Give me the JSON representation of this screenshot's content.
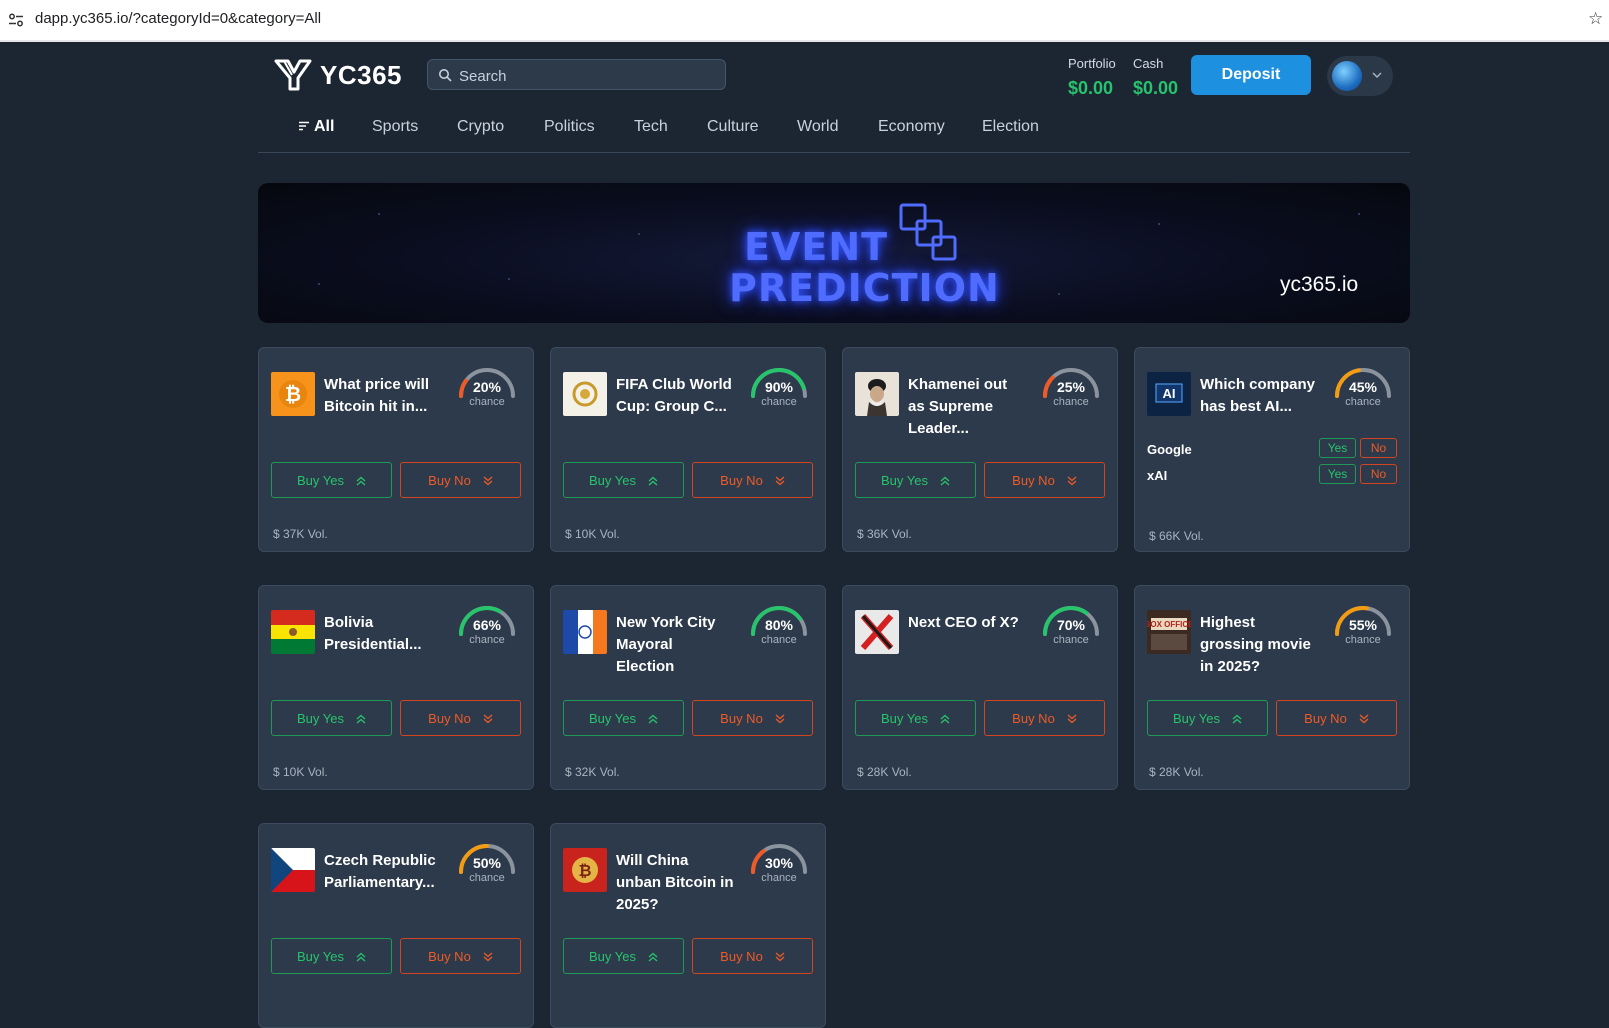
{
  "browser": {
    "url": "dapp.yc365.io/?categoryId=0&category=All"
  },
  "header": {
    "logo_text": "YC365",
    "search_placeholder": "Search",
    "portfolio_label": "Portfolio",
    "portfolio_value": "$0.00",
    "cash_label": "Cash",
    "cash_value": "$0.00",
    "deposit_label": "Deposit"
  },
  "nav": {
    "tabs": [
      {
        "label": "All",
        "active": true
      },
      {
        "label": "Sports"
      },
      {
        "label": "Crypto"
      },
      {
        "label": "Politics"
      },
      {
        "label": "Tech"
      },
      {
        "label": "Culture"
      },
      {
        "label": "World"
      },
      {
        "label": "Economy"
      },
      {
        "label": "Election"
      }
    ]
  },
  "banner": {
    "line1": "EVENT",
    "line2": "PREDICTION",
    "site": "yc365.io"
  },
  "colors": {
    "yes": "#28c46b",
    "no": "#ef5a26",
    "accent": "#1e90e0",
    "gauge_track": "#8a939e",
    "gauge_mid": "#f39c12"
  },
  "buttons": {
    "buy_yes": "Buy Yes",
    "buy_no": "Buy No",
    "yes": "Yes",
    "no": "No",
    "chance": "chance"
  },
  "markets": [
    {
      "title": "What price will Bitcoin hit in...",
      "chance": 20,
      "chance_label": "20%",
      "volume": "$ 37K Vol.",
      "icon": "bitcoin-icon"
    },
    {
      "title": "FIFA Club World Cup: Group C...",
      "chance": 90,
      "chance_label": "90%",
      "volume": "$ 10K Vol.",
      "icon": "fifa-club-world-cup-icon"
    },
    {
      "title": "Khamenei out as Supreme Leader...",
      "chance": 25,
      "chance_label": "25%",
      "volume": "$ 36K Vol.",
      "icon": "khamenei-portrait-icon"
    },
    {
      "title": "Which company has best AI...",
      "chance": 45,
      "chance_label": "45%",
      "volume": "$ 66K Vol.",
      "icon": "ai-icon",
      "options": [
        "Google",
        "xAI"
      ]
    },
    {
      "title": "Bolivia Presidential...",
      "chance": 66,
      "chance_label": "66%",
      "volume": "$ 10K Vol.",
      "icon": "bolivia-flag-icon"
    },
    {
      "title": "New York City Mayoral Election",
      "chance": 80,
      "chance_label": "80%",
      "volume": "$ 32K Vol.",
      "icon": "nyc-flag-icon"
    },
    {
      "title": "Next CEO of X?",
      "chance": 70,
      "chance_label": "70%",
      "volume": "$ 28K Vol.",
      "icon": "x-logo-icon"
    },
    {
      "title": "Highest grossing movie in 2025?",
      "chance": 55,
      "chance_label": "55%",
      "volume": "$ 28K Vol.",
      "icon": "box-office-icon"
    },
    {
      "title": "Czech Republic Parliamentary...",
      "chance": 50,
      "chance_label": "50%",
      "volume": "",
      "icon": "czech-flag-icon"
    },
    {
      "title": "Will China unban Bitcoin in 2025?",
      "chance": 30,
      "chance_label": "30%",
      "volume": "",
      "icon": "china-bitcoin-icon"
    }
  ]
}
